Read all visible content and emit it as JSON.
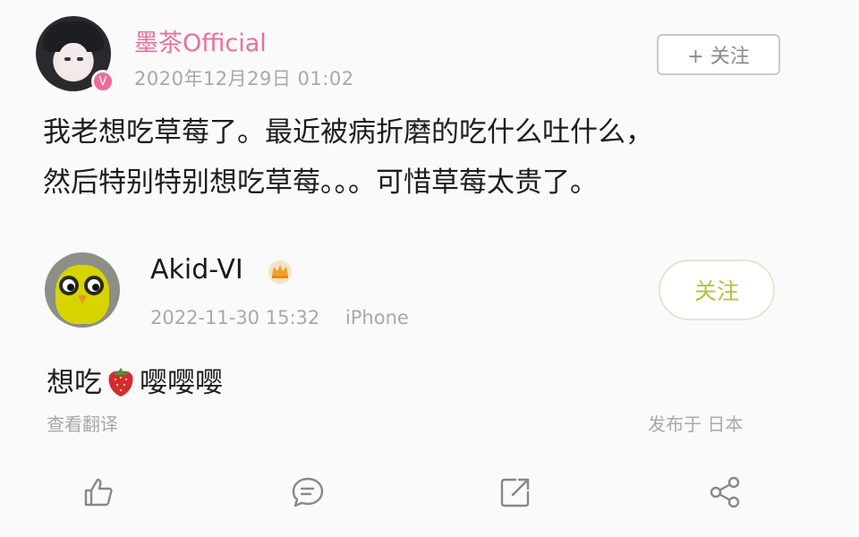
{
  "post1": {
    "username": "墨茶Official",
    "timestamp": "2020年12月29日 01:02",
    "follow_label": "+ 关注",
    "badge": "V",
    "content_line1": "我老想吃草莓了。最近被病折磨的吃什么吐什么，",
    "content_line2": "然后特别特别想吃草莓。。。可惜草莓太贵了。"
  },
  "post2": {
    "username": "Akid-VI",
    "timestamp": "2022-11-30 15:32",
    "device": "iPhone",
    "follow_label": "关注",
    "content_before": "想吃",
    "content_emoji": "strawberry-emoji",
    "content_after": "嘤嘤嘤",
    "translate_label": "查看翻译",
    "location_label": "发布于 日本"
  },
  "actions": [
    "like-icon",
    "comment-icon",
    "share-icon",
    "forward-icon"
  ],
  "colors": {
    "username_pink": "#ec6e9c",
    "follow_green": "#b6c23a",
    "meta_gray": "#a8a8ab",
    "badge_pink": "#f06a9a"
  }
}
